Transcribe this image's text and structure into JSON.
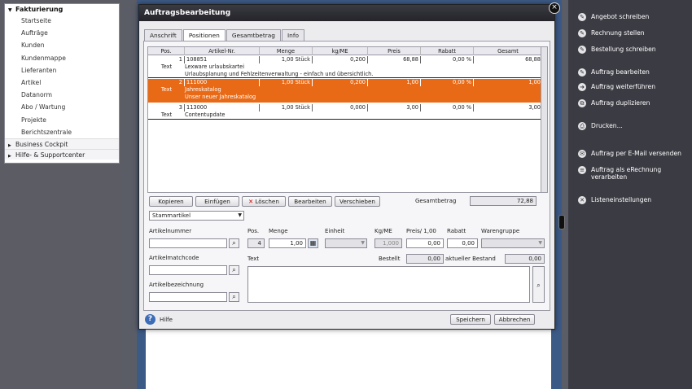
{
  "sidebar": {
    "header": "Fakturierung",
    "items": [
      "Startseite",
      "Aufträge",
      "Kunden",
      "Kundenmappe",
      "Lieferanten",
      "Artikel",
      "Datanorm",
      "Abo / Wartung",
      "Projekte",
      "Berichtszentrale"
    ],
    "groups": [
      "Business Cockpit",
      "Hilfe- & Supportcenter"
    ]
  },
  "right_panel": {
    "items": [
      {
        "label": "Angebot schreiben",
        "icon": "pencil-icon"
      },
      {
        "label": "Rechnung stellen",
        "icon": "pencil-icon"
      },
      {
        "label": "Bestellung schreiben",
        "icon": "pencil-icon"
      },
      {
        "label": "Auftrag bearbeiten",
        "icon": "edit-icon"
      },
      {
        "label": "Auftrag weiterführen",
        "icon": "forward-icon"
      },
      {
        "label": "Auftrag duplizieren",
        "icon": "copy-icon"
      },
      {
        "label": "Drucken...",
        "icon": "print-icon"
      },
      {
        "label": "Auftrag per E-Mail versenden",
        "icon": "mail-icon"
      },
      {
        "label": "Auftrag als eRechnung verarbeiten",
        "icon": "invoice-icon"
      },
      {
        "label": "Listeneinstellungen",
        "icon": "settings-icon"
      }
    ]
  },
  "dialog": {
    "title": "Auftragsbearbeitung",
    "close_symbol": "×",
    "tabs": [
      "Anschrift",
      "Positionen",
      "Gesamtbetrag",
      "Info"
    ],
    "active_tab": 1,
    "table": {
      "columns": [
        "Pos.",
        "Artikel-Nr.",
        "Menge",
        "kg/ME",
        "Preis",
        "Rabatt",
        "Gesamt"
      ],
      "rows": [
        {
          "pos": "1",
          "artikel": "108851",
          "menge": "1,00 Stück",
          "kgme": "0,200",
          "preis": "68,88",
          "rabatt": "0,00 %",
          "gesamt": "68,88",
          "text_label": "Text",
          "text_lines": [
            "Lexware urlaubskartei",
            "Urlaubsplanung und Fehlzeitenverwaltung - einfach und übersichtlich."
          ],
          "selected": false
        },
        {
          "pos": "2",
          "artikel": "111000",
          "menge": "1,00 Stück",
          "kgme": "0,200",
          "preis": "1,00",
          "rabatt": "0,00 %",
          "gesamt": "1,00",
          "text_label": "Text",
          "text_lines": [
            "Jahreskatalog",
            "Unser neuer Jahreskatalog"
          ],
          "selected": true
        },
        {
          "pos": "3",
          "artikel": "113000",
          "menge": "1,00 Stück",
          "kgme": "0,000",
          "preis": "3,00",
          "rabatt": "0,00 %",
          "gesamt": "3,00",
          "text_label": "Text",
          "text_lines": [
            "Contentupdate"
          ],
          "selected": false
        }
      ]
    },
    "buttons": {
      "kopieren": "Kopieren",
      "einfuegen": "Einfügen",
      "loeschen": "Löschen",
      "bearbeiten": "Bearbeiten",
      "verschieben": "Verschieben"
    },
    "gesamtbetrag_label": "Gesamtbetrag",
    "gesamtbetrag_value": "72,88",
    "article_type": "Stammartikel",
    "form": {
      "artikelnummer_label": "Artikelnummer",
      "artikelmatchcode_label": "Artikelmatchcode",
      "artikelbezeichnung_label": "Artikelbezeichnung",
      "pos_label": "Pos.",
      "pos_value": "4",
      "menge_label": "Menge",
      "menge_value": "1,00",
      "einheit_label": "Einheit",
      "kgme_label": "Kg/ME",
      "kgme_value": "1,000",
      "preis_label": "Preis/ 1,00",
      "preis_value": "0,00",
      "rabatt_label": "Rabatt",
      "rabatt_value": "0,00",
      "warengruppe_label": "Warengruppe",
      "text_label": "Text",
      "bestellt_label": "Bestellt",
      "bestellt_value": "0,00",
      "bestand_label": "aktueller Bestand",
      "bestand_value": "0,00"
    },
    "footer": {
      "help": "Hilfe",
      "save": "Speichern",
      "cancel": "Abbrechen"
    }
  }
}
